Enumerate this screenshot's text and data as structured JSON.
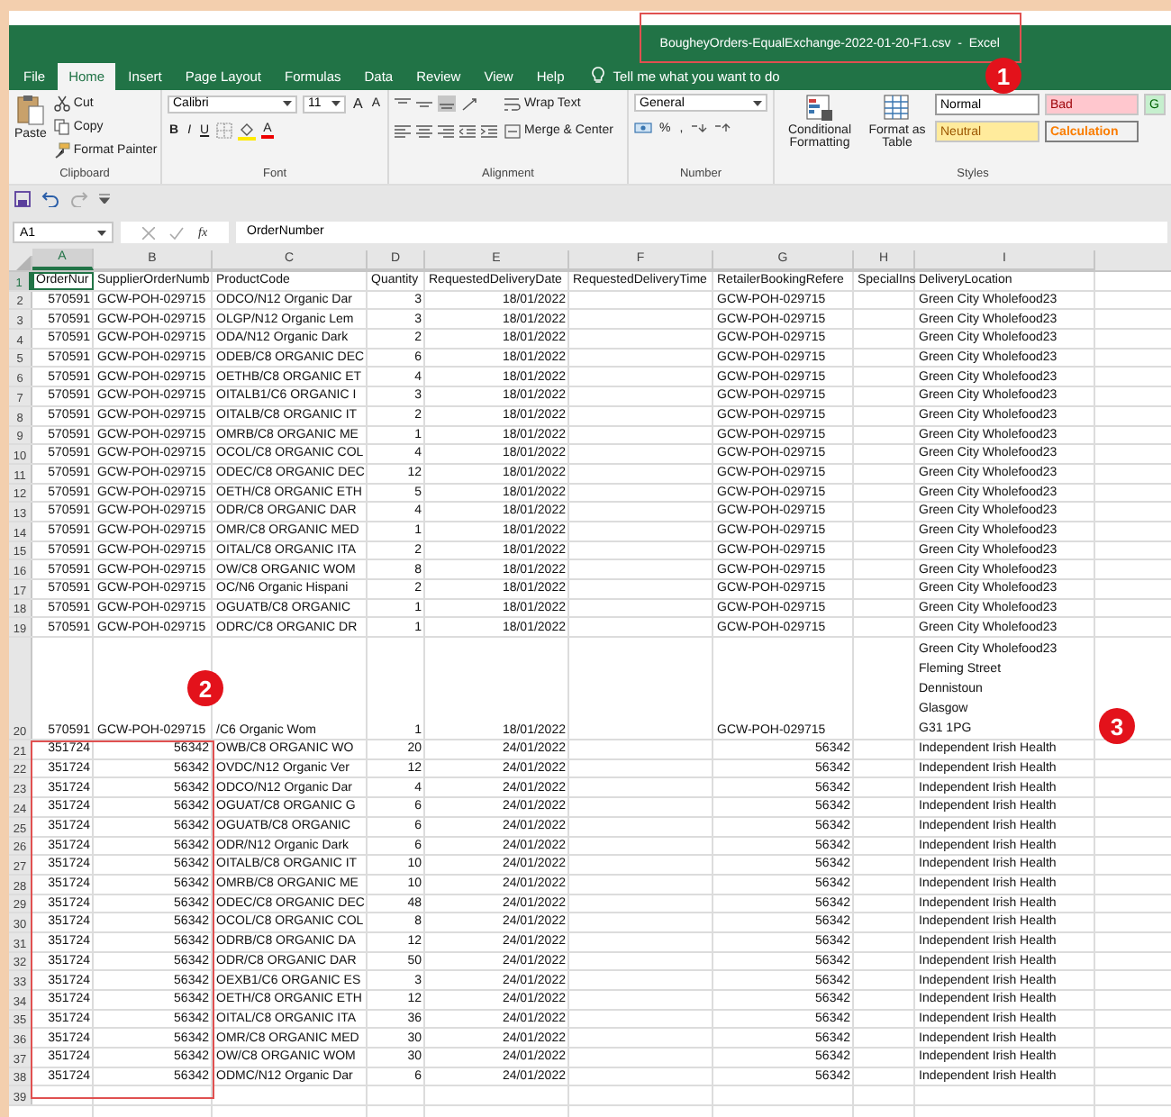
{
  "window": {
    "title": "BougheyOrders-EqualExchange-2022-01-20-F1.csv  -  Excel"
  },
  "tabs": [
    {
      "label": "File",
      "selected": false
    },
    {
      "label": "Home",
      "selected": true
    },
    {
      "label": "Insert",
      "selected": false
    },
    {
      "label": "Page Layout",
      "selected": false
    },
    {
      "label": "Formulas",
      "selected": false
    },
    {
      "label": "Data",
      "selected": false
    },
    {
      "label": "Review",
      "selected": false
    },
    {
      "label": "View",
      "selected": false
    },
    {
      "label": "Help",
      "selected": false
    }
  ],
  "tell_me": "Tell me what you want to do",
  "ribbon": {
    "clipboard": {
      "paste": "Paste",
      "cut": "Cut",
      "copy": "Copy",
      "format_painter": "Format Painter",
      "label": "Clipboard"
    },
    "font": {
      "name": "Calibri",
      "size": "11",
      "grow": "A",
      "shrink": "A",
      "bold": "B",
      "italic": "I",
      "underline": "U",
      "font_color": "A",
      "label": "Font"
    },
    "alignment": {
      "wrap_text": "Wrap Text",
      "merge": "Merge & Center",
      "label": "Alignment"
    },
    "number": {
      "format": "General",
      "percent": "%",
      "comma": ",",
      "label": "Number"
    },
    "styles": {
      "conditional": "Conditional Formatting",
      "format_table": "Format as Table",
      "label": "Styles",
      "cells": [
        {
          "label": "Normal",
          "kind": "normal"
        },
        {
          "label": "Bad",
          "kind": "bad"
        },
        {
          "label": "G",
          "kind": "good"
        },
        {
          "label": "Neutral",
          "kind": "neutral"
        },
        {
          "label": "Calculation",
          "kind": "calculation"
        }
      ]
    }
  },
  "formula_bar": {
    "name_box": "A1",
    "fx": "fx",
    "value": "OrderNumber"
  },
  "columns": [
    {
      "letter": "A",
      "selected": true
    },
    {
      "letter": "B",
      "selected": false
    },
    {
      "letter": "C",
      "selected": false
    },
    {
      "letter": "D",
      "selected": false
    },
    {
      "letter": "E",
      "selected": false
    },
    {
      "letter": "F",
      "selected": false
    },
    {
      "letter": "G",
      "selected": false
    },
    {
      "letter": "H",
      "selected": false
    },
    {
      "letter": "I",
      "selected": false
    }
  ],
  "rows": [
    {
      "n": "1",
      "selected": true,
      "kind": "header",
      "cells": {
        "A": "OrderNur",
        "B": "SupplierOrderNumb",
        "C": "ProductCode",
        "D": "Quantity",
        "E": "RequestedDeliveryDate",
        "F": "RequestedDeliveryTime",
        "G": "RetailerBookingRefere",
        "H": "SpecialIns",
        "I": "DeliveryLocation"
      }
    },
    {
      "n": "2",
      "selected": false,
      "kind": "ref-text",
      "cells": {
        "A": "570591",
        "B": "GCW-POH-029715",
        "C": "ODCO/N12 Organic Dar",
        "D": "3",
        "E": "18/01/2022",
        "G": "GCW-POH-029715",
        "I": "Green City Wholefood23"
      }
    },
    {
      "n": "3",
      "selected": false,
      "kind": "ref-text",
      "cells": {
        "A": "570591",
        "B": "GCW-POH-029715",
        "C": "OLGP/N12 Organic Lem",
        "D": "3",
        "E": "18/01/2022",
        "G": "GCW-POH-029715",
        "I": "Green City Wholefood23"
      }
    },
    {
      "n": "4",
      "selected": false,
      "kind": "ref-text",
      "cells": {
        "A": "570591",
        "B": "GCW-POH-029715",
        "C": "ODA/N12 Organic Dark",
        "D": "2",
        "E": "18/01/2022",
        "G": "GCW-POH-029715",
        "I": "Green City Wholefood23"
      }
    },
    {
      "n": "5",
      "selected": false,
      "kind": "ref-text",
      "cells": {
        "A": "570591",
        "B": "GCW-POH-029715",
        "C": "ODEB/C8 ORGANIC DEC",
        "D": "6",
        "E": "18/01/2022",
        "G": "GCW-POH-029715",
        "I": "Green City Wholefood23"
      }
    },
    {
      "n": "6",
      "selected": false,
      "kind": "ref-text",
      "cells": {
        "A": "570591",
        "B": "GCW-POH-029715",
        "C": "OETHB/C8 ORGANIC ET",
        "D": "4",
        "E": "18/01/2022",
        "G": "GCW-POH-029715",
        "I": "Green City Wholefood23"
      }
    },
    {
      "n": "7",
      "selected": false,
      "kind": "ref-text",
      "cells": {
        "A": "570591",
        "B": "GCW-POH-029715",
        "C": "OITALB1/C6 ORGANIC I",
        "D": "3",
        "E": "18/01/2022",
        "G": "GCW-POH-029715",
        "I": "Green City Wholefood23"
      }
    },
    {
      "n": "8",
      "selected": false,
      "kind": "ref-text",
      "cells": {
        "A": "570591",
        "B": "GCW-POH-029715",
        "C": "OITALB/C8 ORGANIC IT",
        "D": "2",
        "E": "18/01/2022",
        "G": "GCW-POH-029715",
        "I": "Green City Wholefood23"
      }
    },
    {
      "n": "9",
      "selected": false,
      "kind": "ref-text",
      "cells": {
        "A": "570591",
        "B": "GCW-POH-029715",
        "C": "OMRB/C8 ORGANIC ME",
        "D": "1",
        "E": "18/01/2022",
        "G": "GCW-POH-029715",
        "I": "Green City Wholefood23"
      }
    },
    {
      "n": "10",
      "selected": false,
      "kind": "ref-text",
      "cells": {
        "A": "570591",
        "B": "GCW-POH-029715",
        "C": "OCOL/C8 ORGANIC COL",
        "D": "4",
        "E": "18/01/2022",
        "G": "GCW-POH-029715",
        "I": "Green City Wholefood23"
      }
    },
    {
      "n": "11",
      "selected": false,
      "kind": "ref-text",
      "cells": {
        "A": "570591",
        "B": "GCW-POH-029715",
        "C": "ODEC/C8 ORGANIC DEC",
        "D": "12",
        "E": "18/01/2022",
        "G": "GCW-POH-029715",
        "I": "Green City Wholefood23"
      }
    },
    {
      "n": "12",
      "selected": false,
      "kind": "ref-text",
      "cells": {
        "A": "570591",
        "B": "GCW-POH-029715",
        "C": "OETH/C8 ORGANIC ETH",
        "D": "5",
        "E": "18/01/2022",
        "G": "GCW-POH-029715",
        "I": "Green City Wholefood23"
      }
    },
    {
      "n": "13",
      "selected": false,
      "kind": "ref-text",
      "cells": {
        "A": "570591",
        "B": "GCW-POH-029715",
        "C": "ODR/C8 ORGANIC DAR",
        "D": "4",
        "E": "18/01/2022",
        "G": "GCW-POH-029715",
        "I": "Green City Wholefood23"
      }
    },
    {
      "n": "14",
      "selected": false,
      "kind": "ref-text",
      "cells": {
        "A": "570591",
        "B": "GCW-POH-029715",
        "C": "OMR/C8 ORGANIC MED",
        "D": "1",
        "E": "18/01/2022",
        "G": "GCW-POH-029715",
        "I": "Green City Wholefood23"
      }
    },
    {
      "n": "15",
      "selected": false,
      "kind": "ref-text",
      "cells": {
        "A": "570591",
        "B": "GCW-POH-029715",
        "C": "OITAL/C8 ORGANIC ITA",
        "D": "2",
        "E": "18/01/2022",
        "G": "GCW-POH-029715",
        "I": "Green City Wholefood23"
      }
    },
    {
      "n": "16",
      "selected": false,
      "kind": "ref-text",
      "cells": {
        "A": "570591",
        "B": "GCW-POH-029715",
        "C": "OW/C8 ORGANIC WOM",
        "D": "8",
        "E": "18/01/2022",
        "G": "GCW-POH-029715",
        "I": "Green City Wholefood23"
      }
    },
    {
      "n": "17",
      "selected": false,
      "kind": "ref-text",
      "cells": {
        "A": "570591",
        "B": "GCW-POH-029715",
        "C": "OC/N6 Organic Hispani",
        "D": "2",
        "E": "18/01/2022",
        "G": "GCW-POH-029715",
        "I": "Green City Wholefood23"
      }
    },
    {
      "n": "18",
      "selected": false,
      "kind": "ref-text",
      "cells": {
        "A": "570591",
        "B": "GCW-POH-029715",
        "C": "OGUATB/C8 ORGANIC",
        "D": "1",
        "E": "18/01/2022",
        "G": "GCW-POH-029715",
        "I": "Green City Wholefood23"
      }
    },
    {
      "n": "19",
      "selected": false,
      "kind": "ref-text",
      "cells": {
        "A": "570591",
        "B": "GCW-POH-029715",
        "C": "ODRC/C8 ORGANIC DR",
        "D": "1",
        "E": "18/01/2022",
        "G": "GCW-POH-029715",
        "I": "Green City Wholefood23"
      }
    },
    {
      "n": "20",
      "selected": false,
      "kind": "ref-text",
      "cells": {
        "A": "570591",
        "B": "GCW-POH-029715",
        "C": "/C6 Organic Wom",
        "D": "1",
        "E": "18/01/2022",
        "G": "GCW-POH-029715",
        "I": [
          "Green City Wholefood23",
          "Fleming Street",
          "Dennistoun",
          "Glasgow",
          "G31 1PG"
        ]
      }
    },
    {
      "n": "21",
      "selected": false,
      "kind": "ref-number",
      "cells": {
        "A": "351724",
        "B": "56342",
        "C": "OWB/C8 ORGANIC WO",
        "D": "20",
        "E": "24/01/2022",
        "G": "56342",
        "I": "Independent Irish Health"
      }
    },
    {
      "n": "22",
      "selected": false,
      "kind": "ref-number",
      "cells": {
        "A": "351724",
        "B": "56342",
        "C": "OVDC/N12 Organic Ver",
        "D": "12",
        "E": "24/01/2022",
        "G": "56342",
        "I": "Independent Irish Health"
      }
    },
    {
      "n": "23",
      "selected": false,
      "kind": "ref-number",
      "cells": {
        "A": "351724",
        "B": "56342",
        "C": "ODCO/N12 Organic Dar",
        "D": "4",
        "E": "24/01/2022",
        "G": "56342",
        "I": "Independent Irish Health"
      }
    },
    {
      "n": "24",
      "selected": false,
      "kind": "ref-number",
      "cells": {
        "A": "351724",
        "B": "56342",
        "C": "OGUAT/C8 ORGANIC G",
        "D": "6",
        "E": "24/01/2022",
        "G": "56342",
        "I": "Independent Irish Health"
      }
    },
    {
      "n": "25",
      "selected": false,
      "kind": "ref-number",
      "cells": {
        "A": "351724",
        "B": "56342",
        "C": "OGUATB/C8 ORGANIC",
        "D": "6",
        "E": "24/01/2022",
        "G": "56342",
        "I": "Independent Irish Health"
      }
    },
    {
      "n": "26",
      "selected": false,
      "kind": "ref-number",
      "cells": {
        "A": "351724",
        "B": "56342",
        "C": "ODR/N12 Organic Dark",
        "D": "6",
        "E": "24/01/2022",
        "G": "56342",
        "I": "Independent Irish Health"
      }
    },
    {
      "n": "27",
      "selected": false,
      "kind": "ref-number",
      "cells": {
        "A": "351724",
        "B": "56342",
        "C": "OITALB/C8 ORGANIC IT",
        "D": "10",
        "E": "24/01/2022",
        "G": "56342",
        "I": "Independent Irish Health"
      }
    },
    {
      "n": "28",
      "selected": false,
      "kind": "ref-number",
      "cells": {
        "A": "351724",
        "B": "56342",
        "C": "OMRB/C8 ORGANIC ME",
        "D": "10",
        "E": "24/01/2022",
        "G": "56342",
        "I": "Independent Irish Health"
      }
    },
    {
      "n": "29",
      "selected": false,
      "kind": "ref-number",
      "cells": {
        "A": "351724",
        "B": "56342",
        "C": "ODEC/C8 ORGANIC DEC",
        "D": "48",
        "E": "24/01/2022",
        "G": "56342",
        "I": "Independent Irish Health"
      }
    },
    {
      "n": "30",
      "selected": false,
      "kind": "ref-number",
      "cells": {
        "A": "351724",
        "B": "56342",
        "C": "OCOL/C8 ORGANIC COL",
        "D": "8",
        "E": "24/01/2022",
        "G": "56342",
        "I": "Independent Irish Health"
      }
    },
    {
      "n": "31",
      "selected": false,
      "kind": "ref-number",
      "cells": {
        "A": "351724",
        "B": "56342",
        "C": "ODRB/C8 ORGANIC DA",
        "D": "12",
        "E": "24/01/2022",
        "G": "56342",
        "I": "Independent Irish Health"
      }
    },
    {
      "n": "32",
      "selected": false,
      "kind": "ref-number",
      "cells": {
        "A": "351724",
        "B": "56342",
        "C": "ODR/C8 ORGANIC DAR",
        "D": "50",
        "E": "24/01/2022",
        "G": "56342",
        "I": "Independent Irish Health"
      }
    },
    {
      "n": "33",
      "selected": false,
      "kind": "ref-number",
      "cells": {
        "A": "351724",
        "B": "56342",
        "C": "OEXB1/C6 ORGANIC ES",
        "D": "3",
        "E": "24/01/2022",
        "G": "56342",
        "I": "Independent Irish Health"
      }
    },
    {
      "n": "34",
      "selected": false,
      "kind": "ref-number",
      "cells": {
        "A": "351724",
        "B": "56342",
        "C": "OETH/C8 ORGANIC ETH",
        "D": "12",
        "E": "24/01/2022",
        "G": "56342",
        "I": "Independent Irish Health"
      }
    },
    {
      "n": "35",
      "selected": false,
      "kind": "ref-number",
      "cells": {
        "A": "351724",
        "B": "56342",
        "C": "OITAL/C8 ORGANIC ITA",
        "D": "36",
        "E": "24/01/2022",
        "G": "56342",
        "I": "Independent Irish Health"
      }
    },
    {
      "n": "36",
      "selected": false,
      "kind": "ref-number",
      "cells": {
        "A": "351724",
        "B": "56342",
        "C": "OMR/C8 ORGANIC MED",
        "D": "30",
        "E": "24/01/2022",
        "G": "56342",
        "I": "Independent Irish Health"
      }
    },
    {
      "n": "37",
      "selected": false,
      "kind": "ref-number",
      "cells": {
        "A": "351724",
        "B": "56342",
        "C": "OW/C8 ORGANIC WOM",
        "D": "30",
        "E": "24/01/2022",
        "G": "56342",
        "I": "Independent Irish Health"
      }
    },
    {
      "n": "38",
      "selected": false,
      "kind": "ref-number",
      "cells": {
        "A": "351724",
        "B": "56342",
        "C": "ODMC/N12 Organic Dar",
        "D": "6",
        "E": "24/01/2022",
        "G": "56342",
        "I": "Independent Irish Health"
      }
    },
    {
      "n": "39",
      "selected": false,
      "cells": {}
    }
  ],
  "callouts": [
    {
      "number": "1",
      "frame": true
    },
    {
      "number": "2",
      "frame": true
    },
    {
      "number": "3",
      "frame": false
    }
  ]
}
